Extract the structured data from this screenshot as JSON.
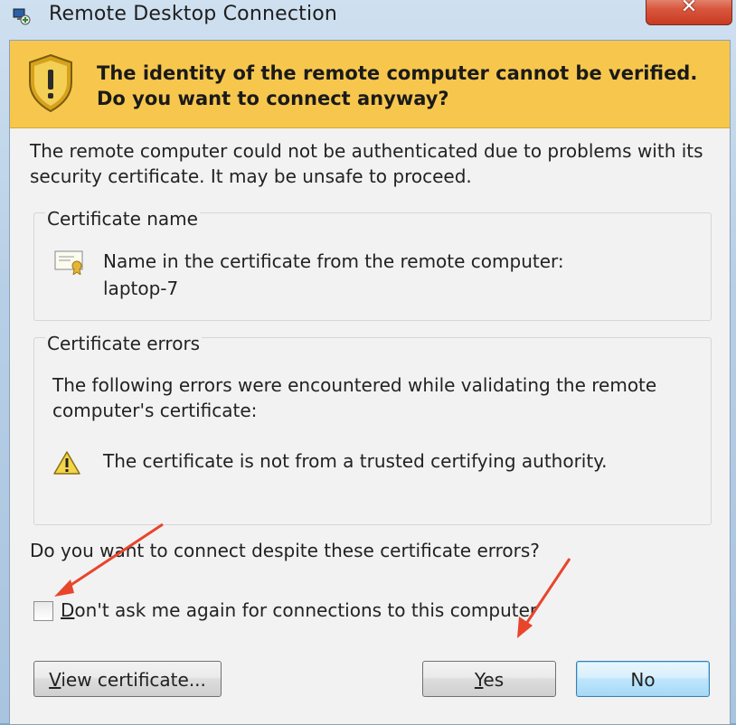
{
  "window": {
    "title": "Remote Desktop Connection",
    "close_glyph": "✕"
  },
  "banner": {
    "heading": "The identity of the remote computer cannot be verified. Do you want to connect anyway?",
    "icon": "shield-warning-icon",
    "color": "#f7c74d"
  },
  "intro": "The remote computer could not be authenticated due to problems with its security certificate. It may be unsafe to proceed.",
  "certificate_name": {
    "legend": "Certificate name",
    "line1": "Name in the certificate from the remote computer:",
    "line2": "laptop-7",
    "icon": "certificate-icon"
  },
  "certificate_errors": {
    "legend": "Certificate errors",
    "description": "The following errors were encountered while validating the remote computer's certificate:",
    "error_item": "The certificate is not from a trusted certifying authority.",
    "icon": "warning-icon"
  },
  "question": "Do you want to connect despite these certificate errors?",
  "checkbox": {
    "label_first": "D",
    "label_rest": "on't ask me again for connections to this computer",
    "checked": false
  },
  "buttons": {
    "view_first": "V",
    "view_rest": "iew certificate...",
    "yes_first": "Y",
    "yes_rest": "es",
    "no": "No"
  },
  "annotation_color": "#e8452c"
}
